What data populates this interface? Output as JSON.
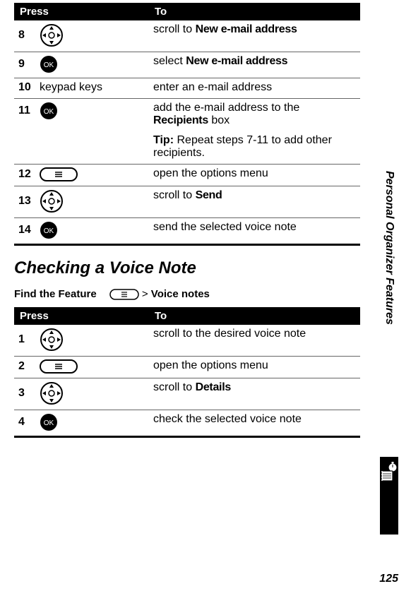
{
  "table1": {
    "headers": {
      "press": "Press",
      "to": "To"
    },
    "rows": [
      {
        "num": "8",
        "key": "dpad",
        "to_pre": "scroll to ",
        "to_bold": "New e-mail address",
        "to_post": ""
      },
      {
        "num": "9",
        "key": "ok",
        "to_pre": "select ",
        "to_bold": "New e-mail address",
        "to_post": ""
      },
      {
        "num": "10",
        "key_text": "keypad keys",
        "to_pre": "enter an e-mail address",
        "to_bold": "",
        "to_post": ""
      },
      {
        "num": "11",
        "key": "ok",
        "to_pre": "add the e-mail address to the ",
        "to_bold": "Recipients",
        "to_post": " box"
      },
      {
        "tip_label": "Tip: ",
        "tip_text": "Repeat steps 7-11 to add other recipients."
      },
      {
        "num": "12",
        "key": "menu",
        "to_pre": "open the options menu",
        "to_bold": "",
        "to_post": ""
      },
      {
        "num": "13",
        "key": "dpad",
        "to_pre": "scroll to ",
        "to_bold": "Send",
        "to_post": ""
      },
      {
        "num": "14",
        "key": "ok",
        "to_pre": "send the selected voice note",
        "to_bold": "",
        "to_post": ""
      }
    ]
  },
  "section_title": "Checking a Voice Note",
  "feature": {
    "label": "Find the Feature",
    "sep": " > ",
    "path_bold": "Voice notes"
  },
  "table2": {
    "headers": {
      "press": "Press",
      "to": "To"
    },
    "rows": [
      {
        "num": "1",
        "key": "dpad",
        "to_pre": "scroll to the desired voice note",
        "to_bold": "",
        "to_post": ""
      },
      {
        "num": "2",
        "key": "menu",
        "to_pre": "open the options menu",
        "to_bold": "",
        "to_post": ""
      },
      {
        "num": "3",
        "key": "dpad",
        "to_pre": "scroll to ",
        "to_bold": "Details",
        "to_post": ""
      },
      {
        "num": "4",
        "key": "ok",
        "to_pre": "check the selected voice note",
        "to_bold": "",
        "to_post": ""
      }
    ]
  },
  "side_label": "Personal Organizer Features",
  "page_number": "125"
}
